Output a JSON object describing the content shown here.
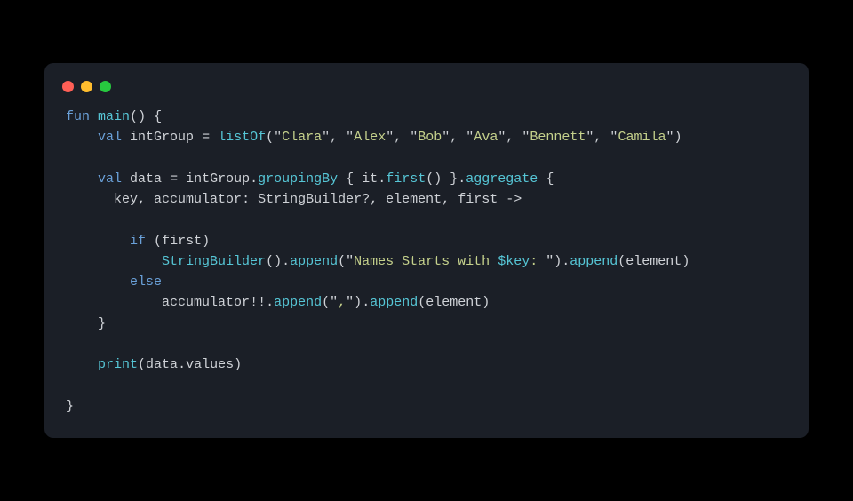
{
  "window": {
    "traffic": [
      "red",
      "yellow",
      "green"
    ]
  },
  "code": {
    "k_fun": "fun",
    "k_main": "main",
    "k_val": "val",
    "k_if": "if",
    "k_else": "else",
    "id_intGroup": "intGroup",
    "id_data": "data",
    "id_listOf": "listOf",
    "id_groupingBy": "groupingBy",
    "id_it": "it",
    "id_first": "first",
    "id_aggregate": "aggregate",
    "id_key": "key",
    "id_accumulator": "accumulator",
    "id_StringBuilder": "StringBuilder",
    "id_element": "element",
    "id_firstParam": "first",
    "id_append": "append",
    "id_print": "print",
    "id_values": "values",
    "str_clara": "Clara",
    "str_alex": "Alex",
    "str_bob": "Bob",
    "str_ava": "Ava",
    "str_bennett": "Bennett",
    "str_camila": "Camila",
    "str_names1": "Names Starts with ",
    "str_names2": ": ",
    "str_comma": ",",
    "interp_key": "$key",
    "sym_q": "\"",
    "sym_op_assign": " = ",
    "sym_lparen": "(",
    "sym_rparen": ")",
    "sym_lbrace": "{",
    "sym_rbrace": "}",
    "sym_dot": ".",
    "sym_comma": ", ",
    "sym_colon": ": ",
    "sym_qmark": "?",
    "sym_arrow": " ->",
    "sym_bangbang": "!!"
  }
}
